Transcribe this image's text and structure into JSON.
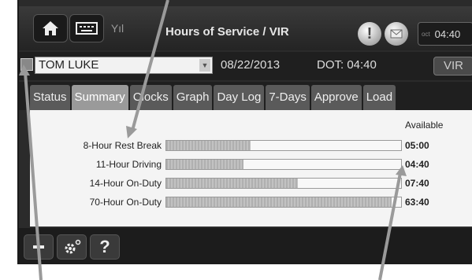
{
  "titlebar": {
    "title": "Hours of Service / VIR",
    "home_icon": "home-icon",
    "keyboard_icon": "keyboard-icon",
    "signal_icon": "signal-icon",
    "signal_text": "Yıl",
    "alert_icon": "alert-icon",
    "alert_text": "!",
    "message_icon": "message-icon",
    "clock_small": "oct",
    "clock_time": "04:40"
  },
  "driver": {
    "name": "TOM LUKE",
    "date": "08/22/2013",
    "dot": "DOT: 04:40",
    "vir_label": "VIR"
  },
  "tabs": [
    {
      "label": "Status"
    },
    {
      "label": "Summary"
    },
    {
      "label": "Clocks"
    },
    {
      "label": "Graph"
    },
    {
      "label": "Day Log"
    },
    {
      "label": "7-Days"
    },
    {
      "label": "Approve"
    },
    {
      "label": "Load"
    }
  ],
  "summary": {
    "available_header": "Available",
    "rows": [
      {
        "label": "8-Hour Rest Break",
        "value": "05:00",
        "fill": 0.36
      },
      {
        "label": "11-Hour Driving",
        "value": "04:40",
        "fill": 0.33
      },
      {
        "label": "14-Hour On-Duty",
        "value": "07:40",
        "fill": 0.56
      },
      {
        "label": "70-Hour On-Duty",
        "value": "63:40",
        "fill": 0.96
      }
    ]
  },
  "bottombar": {
    "back_icon": "back-icon",
    "settings_icon": "settings-icon",
    "help_label": "?"
  },
  "colors": {
    "screen_bg": "#2b2b2b",
    "content_bg": "#f4f4f4",
    "tab_active": "#9a9a9a",
    "tab_inactive": "#5a5a5a"
  }
}
